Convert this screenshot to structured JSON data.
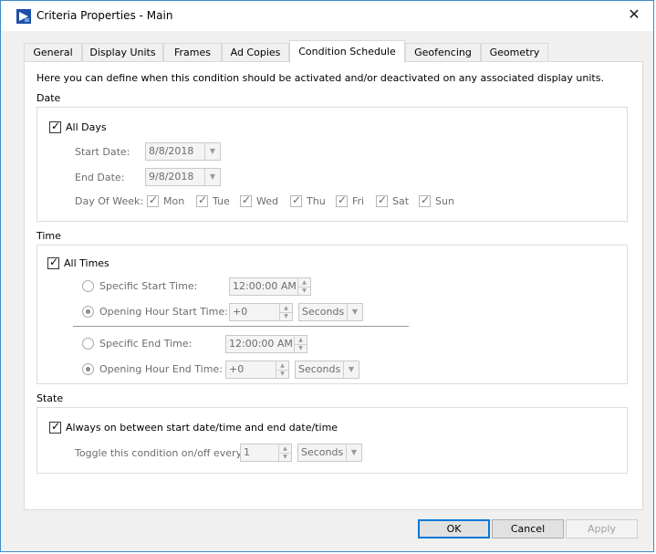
{
  "window": {
    "title": "Criteria Properties - Main",
    "close_glyph": "✕"
  },
  "tabs": [
    {
      "label": "General"
    },
    {
      "label": "Display Units"
    },
    {
      "label": "Frames"
    },
    {
      "label": "Ad Copies"
    },
    {
      "label": "Condition Schedule",
      "active": true
    },
    {
      "label": "Geofencing"
    },
    {
      "label": "Geometry"
    }
  ],
  "intro": "Here you can define when this condition should be activated and/or deactivated on any associated display units.",
  "date": {
    "section_label": "Date",
    "all_days": {
      "label": "All Days",
      "checked": true
    },
    "start_date": {
      "label": "Start Date:",
      "value": "8/8/2018"
    },
    "end_date": {
      "label": "End Date:",
      "value": "9/8/2018"
    },
    "day_of_week_label": "Day Of Week:",
    "days": [
      {
        "label": "Mon",
        "checked": true
      },
      {
        "label": "Tue",
        "checked": true
      },
      {
        "label": "Wed",
        "checked": true
      },
      {
        "label": "Thu",
        "checked": true
      },
      {
        "label": "Fri",
        "checked": true
      },
      {
        "label": "Sat",
        "checked": true
      },
      {
        "label": "Sun",
        "checked": true
      }
    ]
  },
  "time": {
    "section_label": "Time",
    "all_times": {
      "label": "All Times",
      "checked": true
    },
    "specific_start": {
      "label": "Specific Start Time:",
      "value": "12:00:00 AM",
      "selected": false
    },
    "opening_start": {
      "label": "Opening Hour Start Time:",
      "value": "+0",
      "unit": "Seconds",
      "selected": true
    },
    "specific_end": {
      "label": "Specific End Time:",
      "value": "12:00:00 AM",
      "selected": false
    },
    "opening_end": {
      "label": "Opening Hour End Time:",
      "value": "+0",
      "unit": "Seconds",
      "selected": true
    }
  },
  "state": {
    "section_label": "State",
    "always_on": {
      "label": "Always on between start date/time and end date/time",
      "checked": true
    },
    "toggle": {
      "label": "Toggle this condition on/off every",
      "value": "1",
      "unit": "Seconds"
    }
  },
  "buttons": {
    "ok": "OK",
    "cancel": "Cancel",
    "apply": "Apply"
  },
  "glyphs": {
    "check": "✓",
    "dropdown": "▼",
    "spin_up": "▲",
    "spin_down": "▼"
  }
}
